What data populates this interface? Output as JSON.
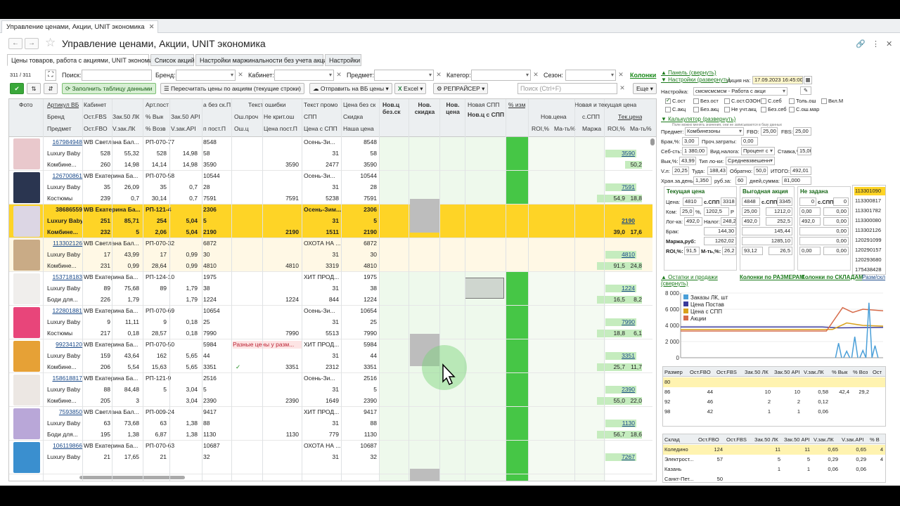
{
  "window_tab": {
    "label": "Управление ценами, Акции, UNIT экономика"
  },
  "page_title": "Управление ценами, Акции, UNIT экономика",
  "form_tabs": [
    "Цены товаров, работа с акциями, UNIT экономика",
    "Список акций",
    "Настройки маржинальности без учета акций",
    "Настройки"
  ],
  "filters": {
    "counter": "311 / 311",
    "search_label": "Поиск:",
    "brand_label": "Бренд:",
    "cabinet_label": "Кабинет:",
    "subject_label": "Предмет:",
    "category_label": "Категор:",
    "season_label": "Сезон:",
    "columns_link": "Колонки"
  },
  "toolbar": {
    "fill_table": "Заполнить таблицу данными",
    "recalc": "Пересчитать цены по акциям (текущие строки)",
    "send": "Отправить на ВБ цены",
    "excel": "Excel",
    "repricer": "РЕПРАЙСЕР",
    "search_placeholder": "Поиск (Ctrl+F)",
    "more": "Еще"
  },
  "headers": {
    "photo": "Фото",
    "article": "Артикул ВБ",
    "brand": "Бренд",
    "subject": "Предмет",
    "cabinet": "Кабинет",
    "ost_fbs": "Ост.FBS",
    "ost_fbo": "Ост.FBO",
    "zak50lk": "Зак.50 ЛК",
    "vzak_lk": "V.зак.ЛК",
    "art_post": "Арт.пост",
    "pvyk": "% Вык",
    "pvozv": "% Возв",
    "zak50api": "Зак.50 API",
    "vzak_api": "V.зак.API",
    "bez_sk_p": "а без ск.П",
    "p_post": "п пост.П",
    "text_err": "Текст ошибки",
    "osh_proch": "Ош.проч",
    "osh_c": "Ош.ц",
    "ne_krit": "Не крит.ош",
    "price_post": "Цена пост.П",
    "text_promo": "Текст промо",
    "spp": "СПП",
    "price_spp": "Цена с СПП",
    "price_bez_sk": "Цена без ск",
    "discount": "Скидка",
    "our_price": "Наша цена",
    "new_c_bez_sk": "Нов.ц без.ск",
    "new_disc": "Нов. скидка",
    "new_price": "Нов. цена",
    "new_spp": "Новая СПП",
    "new_c_spp": "Нов.ц с СПП",
    "pct_change": "% изм",
    "new_cur": "Новая и текущая цена",
    "new_price2": "Нов.цена",
    "c_spp": "с.СПП",
    "cur_price": "Тек.цена",
    "roi": "ROI,%",
    "margin_pct": "Ма-ть%",
    "marja": "Маржа"
  },
  "rows": [
    {
      "art": "167984948",
      "brand": "Luxury Baby",
      "subj": "Комбине...",
      "cab": "WB Светлана Бал...",
      "fbs": "528",
      "fbo": "260",
      "lk": "55,32",
      "vlk": "14,98",
      "apost": "РП-070-77",
      "vyk": "528",
      "vozv": "14,14",
      "api": "14,98",
      "bsk": "8548",
      "p2": "58",
      "pp": "3590",
      "ne": "3590",
      "promo": "Осень-Зи...",
      "spp": "31",
      "cspp": "2477",
      "pb": "8548",
      "sk": "58",
      "our": "3590",
      "cur": "3590",
      "roi": "",
      "mt": "50,2",
      "thumb": "#e9c8cc"
    },
    {
      "art": "126700861",
      "brand": "Luxury Baby",
      "subj": "Костюмы",
      "cab": "WB Екатерина Ба...",
      "fbs": "35",
      "fbo": "239",
      "lk": "26,09",
      "vlk": "0,7",
      "apost": "РП-070-58",
      "vyk": "35",
      "vozv": "30,14",
      "api": "0,7",
      "bsk": "10544",
      "p2": "28",
      "pp": "7591",
      "ne": "7591",
      "promo": "Осень-Зи...",
      "spp": "31",
      "cspp": "5238",
      "pb": "10544",
      "sk": "28",
      "our": "7591",
      "cur": "7591",
      "roi": "54,9",
      "mt": "18,8",
      "thumb": "#2a3550"
    },
    {
      "art": "38686559",
      "brand": "Luxury Baby",
      "subj": "Комбине...",
      "cab": "WB Екатерина Ба...",
      "fbs": "251",
      "fbo": "232",
      "lk": "85,71",
      "vlk": "5",
      "apost": "РП-121-4",
      "vyk": "254",
      "vozv": "2,06",
      "api": "5,04",
      "bsk": "2306",
      "p2": "5",
      "pp": "2190",
      "ne": "2190",
      "promo": "Осень-Зим...",
      "spp": "31",
      "cspp": "1511",
      "pb": "2306",
      "sk": "5",
      "our": "2190",
      "cur": "2190",
      "roi": "39,0",
      "mt": "17,6",
      "thumb": "#dcd6e4"
    },
    {
      "art": "113302126",
      "brand": "Luxury Baby",
      "subj": "Комбине...",
      "cab": "WB Светлана Бал...",
      "fbs": "17",
      "fbo": "231",
      "lk": "43,99",
      "vlk": "0,99",
      "apost": "РП-070-32",
      "vyk": "17",
      "vozv": "28,64",
      "api": "0,99",
      "bsk": "6872",
      "p2": "30",
      "pp": "4810",
      "ne": "4810",
      "promo": "ОХОТА НА ...",
      "spp": "31",
      "cspp": "3319",
      "pb": "6872",
      "sk": "30",
      "our": "4810",
      "cur": "4810",
      "roi": "91,5",
      "mt": "24,8",
      "thumb": "#c9ab86"
    },
    {
      "art": "153718183",
      "brand": "Luxury Baby",
      "subj": "Боди для...",
      "cab": "WB Екатерина Ба...",
      "fbs": "89",
      "fbo": "226",
      "lk": "75,68",
      "vlk": "1,79",
      "apost": "РП-124-10",
      "vyk": "89",
      "vozv": "",
      "api": "1,79",
      "bsk": "1975",
      "p2": "38",
      "pp": "1224",
      "ne": "1224",
      "promo": "ХИТ ПРОД...",
      "spp": "31",
      "cspp": "844",
      "pb": "1975",
      "sk": "38",
      "our": "1224",
      "cur": "1224",
      "roi": "16,5",
      "mt": "8,2",
      "thumb": "#f0eeec"
    },
    {
      "art": "122801881",
      "brand": "Luxury Baby",
      "subj": "Костюмы",
      "cab": "WB Екатерина Ба...",
      "fbs": "9",
      "fbo": "217",
      "lk": "11,11",
      "vlk": "0,18",
      "apost": "РП-070-69",
      "vyk": "9",
      "vozv": "28,57",
      "api": "0,18",
      "bsk": "10654",
      "p2": "25",
      "pp": "7990",
      "ne": "7990",
      "promo": "Осень-Зи...",
      "spp": "31",
      "cspp": "5513",
      "pb": "10654",
      "sk": "25",
      "our": "7990",
      "cur": "7990",
      "roi": "18,8",
      "mt": "6,1",
      "thumb": "#e8457a"
    },
    {
      "art": "99234120",
      "brand": "Luxury Baby",
      "subj": "Комбине...",
      "cab": "WB Екатерина Ба...",
      "fbs": "159",
      "fbo": "206",
      "lk": "43,64",
      "vlk": "5,54",
      "apost": "РП-070-50",
      "vyk": "162",
      "vozv": "15,63",
      "api": "5,65",
      "bsk": "5984",
      "p2": "44",
      "pp": "3351",
      "ne": "3351",
      "promo": "ХИТ ПРОД...",
      "spp": "31",
      "cspp": "2312",
      "pb": "5984",
      "sk": "44",
      "our": "3351",
      "cur": "3351",
      "roi": "25,7",
      "mt": "11,7",
      "thumb": "#e6a136",
      "err": "Разные цены у разм..."
    },
    {
      "art": "158618817",
      "brand": "Luxury Baby",
      "subj": "Комбине...",
      "cab": "WB Екатерина Ба...",
      "fbs": "88",
      "fbo": "205",
      "lk": "84,48",
      "vlk": "3",
      "apost": "РП-121-9",
      "vyk": "5",
      "vozv": "",
      "api": "3,04",
      "bsk": "2516",
      "p2": "5",
      "pp": "2390",
      "ne": "2390",
      "promo": "Осень-Зи...",
      "spp": "31",
      "cspp": "1649",
      "pb": "2516",
      "sk": "5",
      "our": "2390",
      "cur": "2390",
      "roi": "55,0",
      "mt": "22,0",
      "thumb": "#ece7e3"
    },
    {
      "art": "7593850",
      "brand": "Luxury Baby",
      "subj": "Боди для...",
      "cab": "WB Светлана Бал...",
      "fbs": "63",
      "fbo": "195",
      "lk": "73,68",
      "vlk": "1,38",
      "apost": "РП-009-24",
      "vyk": "63",
      "vozv": "6,87",
      "api": "1,38",
      "bsk": "9417",
      "p2": "88",
      "pp": "1130",
      "ne": "1130",
      "promo": "ХИТ ПРОД...",
      "spp": "31",
      "cspp": "779",
      "pb": "9417",
      "sk": "88",
      "our": "1130",
      "cur": "1130",
      "roi": "56,7",
      "mt": "18,6",
      "thumb": "#b9a7d8"
    },
    {
      "art": "106119866",
      "brand": "Luxury Baby",
      "subj": "",
      "cab": "WB Екатерина Ба...",
      "fbs": "21",
      "fbo": "",
      "lk": "17,65",
      "vlk": "",
      "apost": "РП-070-63",
      "vyk": "21",
      "vozv": "",
      "api": "",
      "bsk": "10687",
      "p2": "32",
      "pp": "",
      "ne": "",
      "promo": "ОХОТА НА ...",
      "spp": "31",
      "cspp": "",
      "pb": "10687",
      "sk": "32",
      "our": "",
      "cur": "7267",
      "roi": "",
      "mt": "",
      "thumb": "#3a8fcf"
    }
  ],
  "right_panel": {
    "panel_link": "▲ Панель (свернуть)",
    "settings_link": "▼ Настройки (развернуть)",
    "action_label": "Акция на:",
    "action_date": "17.09.2023 16:45:00",
    "setting_label": "Настройка:",
    "setting_value": "смсмсмсмсм - Работа с акци",
    "checkboxes": [
      "С.ост",
      "Без.ост",
      "С.ост.ОЗОН",
      "С.себ",
      "Толь.ош",
      "Вкл.М",
      "С.акц",
      "Без.акц",
      "Не учт.акц",
      "Без.себ",
      "С.ош.мар"
    ],
    "calc_link": "▼ Калькулятор (развернуть)",
    "calc_note": "Поле можно менять значения, они не записываются в базу данных",
    "subject_label": "Предмет:",
    "subject_value": "Комбинезоны",
    "fbo_label": "FBO:",
    "fbo_value": "25,00",
    "fbs_label": "FBS:",
    "fbs_value": "25,00",
    "brak_label": "Брак,%:",
    "brak_value": "3,00",
    "proch_label": "Проч.затраты:",
    "proch_value": "0,00",
    "seb_label": "Себ-сть:",
    "seb_value": "1 380,00",
    "vid_label": "Вид.налога:",
    "vid_value": "Процент с",
    "stavka_label": "Ставка,%:",
    "stavka_value": "15,00",
    "vyk_label": "Вык,%:",
    "vyk_value": "43,99",
    "tip_label": "Тип ло-ки:",
    "tip_value": "Средневзвешенн",
    "vl_label": "V.л:",
    "vl_value": "20,25",
    "tuda_label": "Туда:",
    "tuda_value": "188,43",
    "obr_label": "Обратно:",
    "obr_value": "50,0",
    "itogo_label": "ИТОГО:",
    "itogo_value": "492,01",
    "hran_label": "Хран.за.день:",
    "hran_value": "1,350",
    "rub_label": "руб.за:",
    "rub_value": "60",
    "days_label": "дней,сумма:",
    "days_value": "81,000",
    "box1_title": "Текущая цена",
    "box2_title": "Выгодная акция",
    "box3_title": "Не задана",
    "price_label": "Цена:",
    "price_value": "4810",
    "cspp_label": "с.СПП",
    "cspp_value": "3318",
    "box2_price": "4848",
    "box2_cspp": "3345",
    "box3_price": "0",
    "box3_cspp": "0",
    "kom_label": "Ком:",
    "kom_pct": "25,0",
    "kom_value": "1202,5",
    "kom_r": "Р",
    "box2_kom_pct": "25,00",
    "box2_kom": "1212,0",
    "box3_kom_pct": "0,00",
    "box3_kom": "0,00",
    "log_label": "Лог-ка:",
    "log_value": "492,0",
    "nalog_label": "Налог:",
    "nalog_value": "248,2",
    "box2_log": "492,0",
    "box2_nalog": "252,5",
    "box3_log": "492,0",
    "box3_nalog": "0,00",
    "brak2_label": "Брак:",
    "brak2_value": "144,30",
    "box2_brak": "145,44",
    "box3_brak": "0,00",
    "marja_label": "Маржа,руб:",
    "marja_value": "1262,02",
    "box2_marja": "1285,10",
    "box3_marja": "0,00",
    "roi_label": "ROI,%:",
    "roi_value": "91,5",
    "mt_label": "М-ть,%:",
    "mt_value": "26,2",
    "box2_roi": "93,12",
    "box2_mt": "26,5",
    "box3_roi": "0,00",
    "box3_mt": "0,00",
    "ids": [
      "113301090",
      "113300817",
      "113301782",
      "113300080",
      "113302126",
      "120291099",
      "120290157",
      "120293680",
      "175438428"
    ],
    "stocks_link": "▲ Остатки и продажи (свернуть)",
    "cols_size": "Колонки по РАЗМЕРАМ",
    "cols_wh": "Колонки по СКЛАДАМ",
    "size_link": "Разм/скл"
  },
  "chart_data": {
    "type": "line",
    "series": [
      {
        "name": "Заказы ЛК, шт",
        "color": "#4a9fd8"
      },
      {
        "name": "Цена Постав",
        "color": "#3b3b9b"
      },
      {
        "name": "Цена с СПП",
        "color": "#d9a11a"
      },
      {
        "name": "Акции",
        "color": "#d66b4a"
      }
    ],
    "y_ticks": [
      "8 000",
      "6 000",
      "4 000",
      "2 000",
      "0"
    ],
    "ylim": [
      0,
      8000
    ]
  },
  "size_table": {
    "headers": [
      "Размер",
      "Ост.FBO",
      "Ост.FBS",
      "Зак.50 ЛК",
      "Зак.50 API",
      "V.зак.ЛК",
      "% Вык",
      "% Воз",
      "Ост"
    ],
    "rows": [
      [
        "80",
        "",
        "",
        "",
        "",
        "",
        "",
        "",
        ""
      ],
      [
        "86",
        "44",
        "",
        "10",
        "10",
        "0,58",
        "42,4",
        "29,2",
        ""
      ],
      [
        "92",
        "46",
        "",
        "2",
        "2",
        "0,12",
        "",
        "",
        ""
      ],
      [
        "98",
        "42",
        "",
        "1",
        "1",
        "0,06",
        "",
        "",
        ""
      ]
    ]
  },
  "wh_table": {
    "headers": [
      "Склад",
      "Ост.FBO",
      "Ост.FBS",
      "Зак.50 ЛК",
      "Зак.50 API",
      "V.зак.ЛК",
      "V.зак.API",
      "% В"
    ],
    "rows": [
      [
        "Коледино",
        "124",
        "",
        "11",
        "11",
        "0,65",
        "0,65",
        "4"
      ],
      [
        "Электрост...",
        "57",
        "",
        "5",
        "5",
        "0,29",
        "0,29",
        "4"
      ],
      [
        "Казань",
        "",
        "",
        "1",
        "1",
        "0,06",
        "0,06",
        ""
      ],
      [
        "Санкт-Пет...",
        "50",
        "",
        "",
        "",
        "",
        "",
        ""
      ]
    ]
  }
}
